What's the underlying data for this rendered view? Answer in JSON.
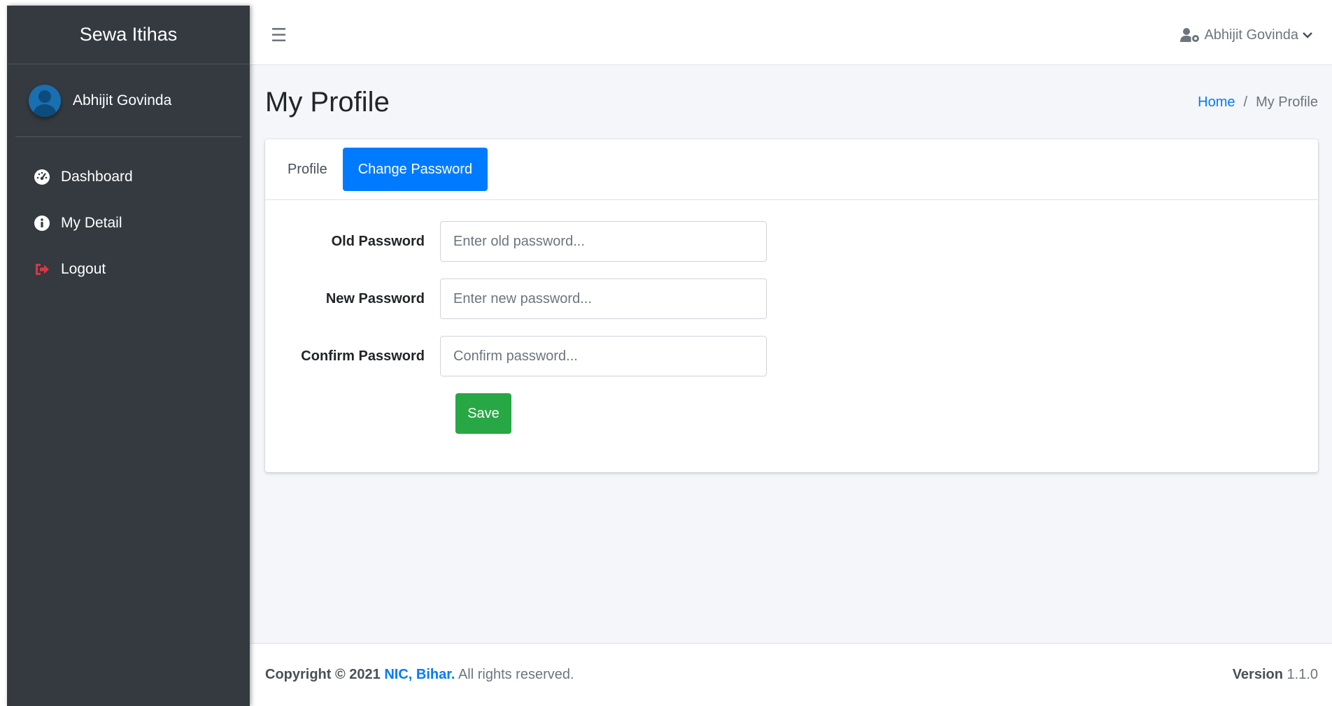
{
  "brand": {
    "title": "Sewa Itihas"
  },
  "sidebar": {
    "user_name": "Abhijit Govinda",
    "items": [
      {
        "label": "Dashboard",
        "icon": "tachometer-icon",
        "icon_color": "#ffffff"
      },
      {
        "label": "My Detail",
        "icon": "info-circle-icon",
        "icon_color": "#ffffff"
      },
      {
        "label": "Logout",
        "icon": "sign-out-icon",
        "icon_color": "#dc3545"
      }
    ]
  },
  "topbar": {
    "menu_icon": "hamburger-icon",
    "user_label": "Abhijit Govinda",
    "user_icon": "user-cog-icon"
  },
  "header": {
    "title": "My Profile",
    "breadcrumb": {
      "home": "Home",
      "separator": "/",
      "current": "My Profile"
    }
  },
  "tabs": [
    {
      "label": "Profile",
      "active": false
    },
    {
      "label": "Change Password",
      "active": true
    }
  ],
  "form": {
    "old_password": {
      "label": "Old Password",
      "placeholder": "Enter old password..."
    },
    "new_password": {
      "label": "New Password",
      "placeholder": "Enter new password..."
    },
    "confirm_password": {
      "label": "Confirm Password",
      "placeholder": "Confirm password..."
    },
    "save_label": "Save"
  },
  "footer": {
    "copyright_prefix": "Copyright © 2021",
    "org": "NIC, Bihar.",
    "rights": "All rights reserved.",
    "version_label": "Version",
    "version_value": "1.1.0"
  },
  "colors": {
    "sidebar_bg": "#343a40",
    "primary": "#007bff",
    "success": "#28a745",
    "danger": "#dc3545"
  }
}
